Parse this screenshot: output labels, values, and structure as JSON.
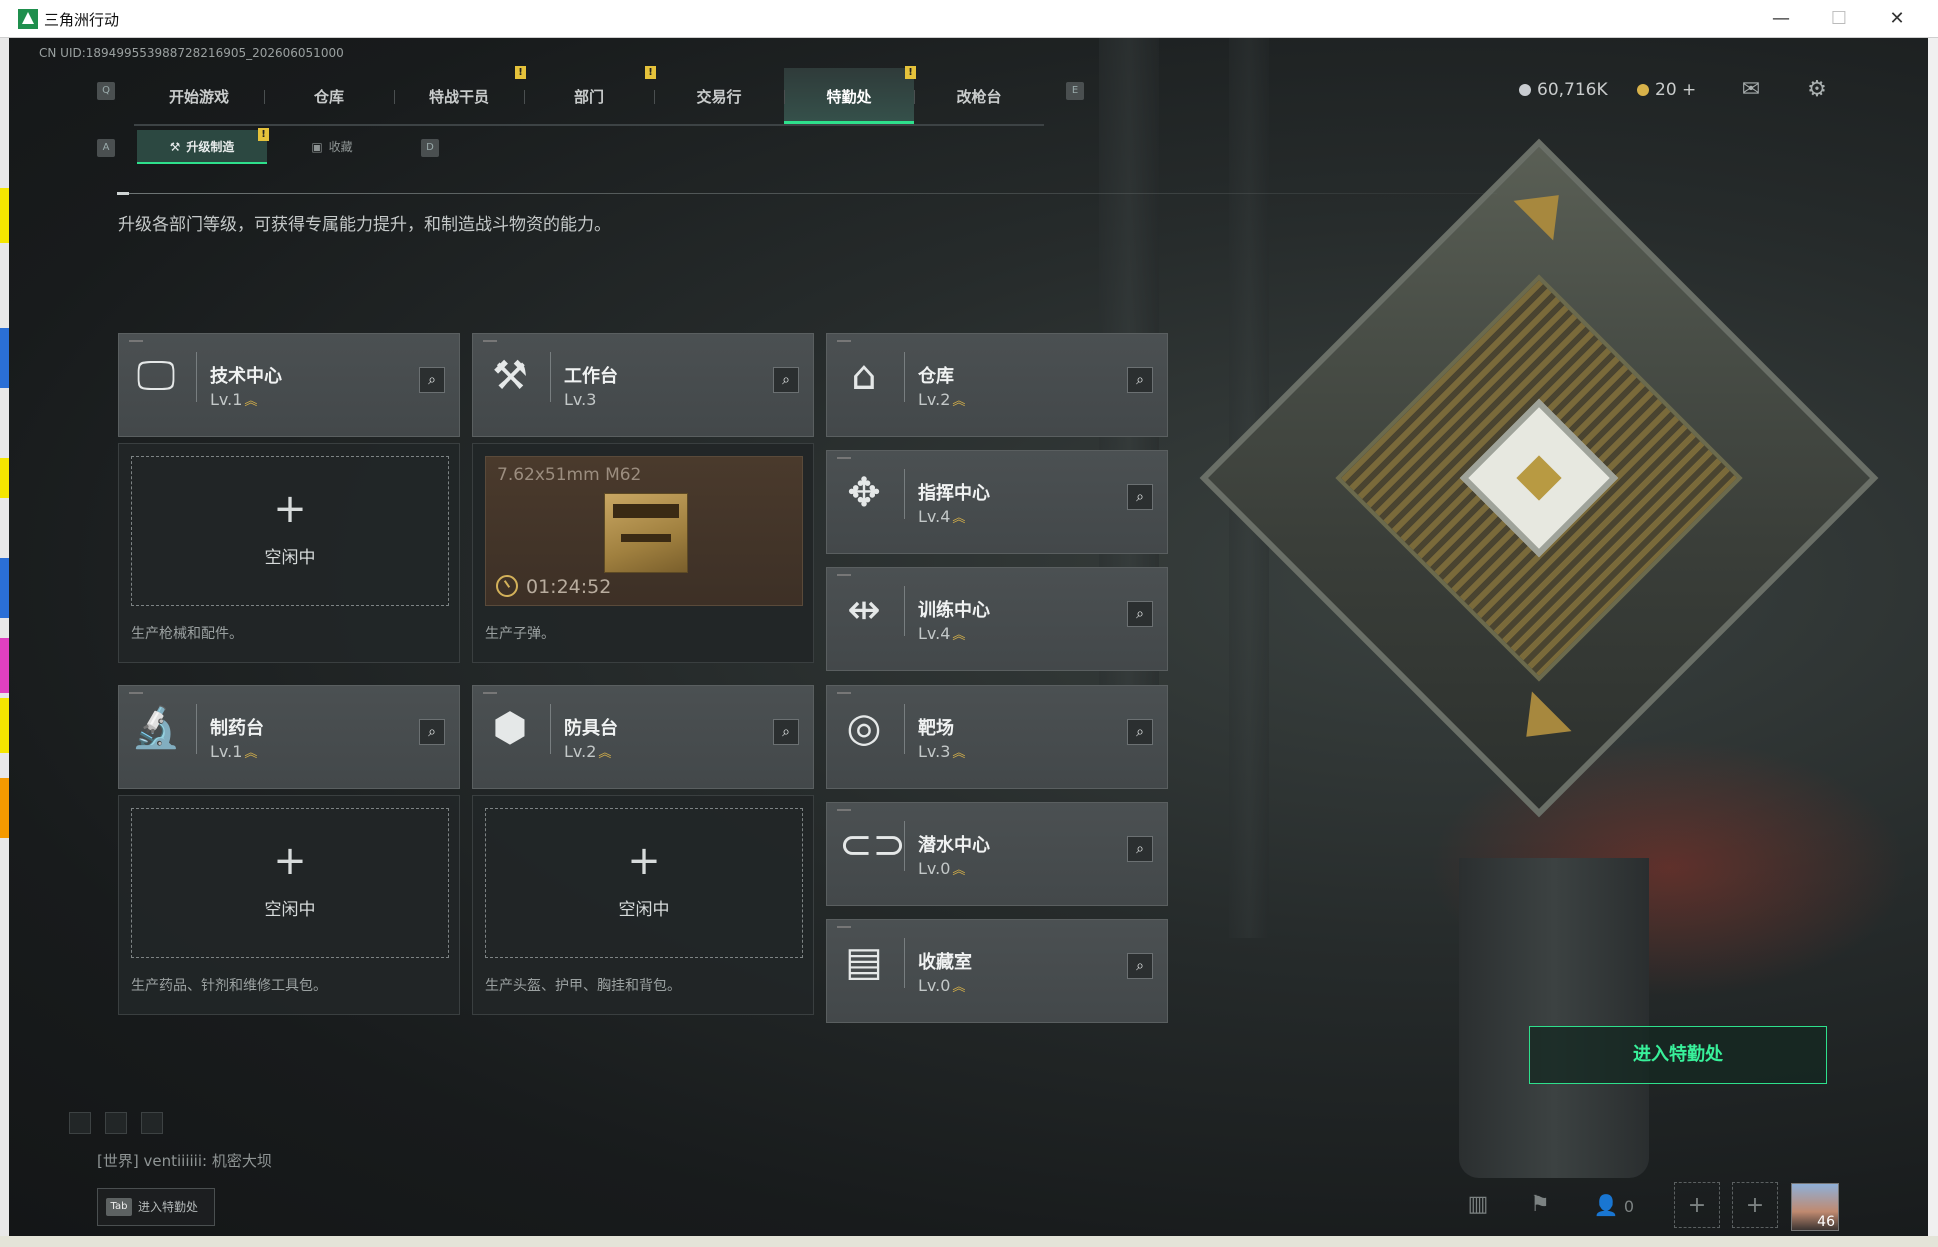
{
  "window": {
    "title": "三角洲行动",
    "minimize": "—",
    "maximize": "☐",
    "close": "✕"
  },
  "uid_text": "CN UID:18949955398872821690​5_202606051000",
  "nav": {
    "left_key": "Q",
    "right_key": "E",
    "tabs": [
      {
        "label": "开始游戏",
        "badge": ""
      },
      {
        "label": "仓库",
        "badge": ""
      },
      {
        "label": "特战干员",
        "badge": "!"
      },
      {
        "label": "部门",
        "badge": "!"
      },
      {
        "label": "交易行",
        "badge": ""
      },
      {
        "label": "特勤处",
        "badge": "!"
      },
      {
        "label": "改枪台",
        "badge": ""
      }
    ],
    "active": "特勤处"
  },
  "currency": {
    "silver": "60,716K",
    "gold": "20 +",
    "silver_color": "#c8ccd0",
    "gold_color": "#d8b24a"
  },
  "top_icons": {
    "mail": "mail-icon",
    "settings": "gear-icon"
  },
  "subnav": {
    "left_key": "A",
    "right_key": "D",
    "tabs": [
      {
        "label": "升级制造",
        "badge": "!"
      },
      {
        "label": "收藏",
        "badge": ""
      }
    ],
    "active": "升级制造"
  },
  "description": "升级各部门等级，可获得专属能力提升，和制造战斗物资的能力。",
  "departments": [
    {
      "name": "技术中心",
      "level": "Lv.1",
      "icon": "monitor-icon"
    },
    {
      "name": "工作台",
      "level": "Lv.3",
      "icon": "tools-icon"
    },
    {
      "name": "仓库",
      "level": "Lv.2",
      "icon": "warehouse-icon"
    },
    {
      "name": "指挥中心",
      "level": "Lv.4",
      "icon": "command-icon"
    },
    {
      "name": "训练中心",
      "level": "Lv.4",
      "icon": "dumbbell-icon"
    },
    {
      "name": "制药台",
      "level": "Lv.1",
      "icon": "microscope-icon"
    },
    {
      "name": "防具台",
      "level": "Lv.2",
      "icon": "armor-icon"
    },
    {
      "name": "靶场",
      "level": "Lv.3",
      "icon": "target-icon"
    },
    {
      "name": "潜水中心",
      "level": "Lv.0",
      "icon": "diving-mask-icon"
    },
    {
      "name": "收藏室",
      "level": "Lv.0",
      "icon": "collection-icon"
    }
  ],
  "production": {
    "tech": {
      "status": "空闲中",
      "plus": "+",
      "desc": "生产枪械和配件。"
    },
    "workbench": {
      "item": "7.62x51mm M62",
      "timer": "01:24:52",
      "desc": "生产子弹。"
    },
    "pharmacy": {
      "status": "空闲中",
      "plus": "+",
      "desc": "生产药品、针剂和维修工具包。"
    },
    "armor": {
      "status": "空闲中",
      "plus": "+",
      "desc": "生产头盔、护甲、胸挂和背包。"
    }
  },
  "enter_button": "进入特勤处",
  "chat": {
    "channel": "[世界]",
    "message": "ventiiiiii: 机密大坝"
  },
  "tab_hint": {
    "key": "Tab",
    "label": "进入特勤处"
  },
  "bottom_bar": {
    "team_count": "0",
    "avatar_level": "46"
  },
  "accent_color": "#2ee08c"
}
